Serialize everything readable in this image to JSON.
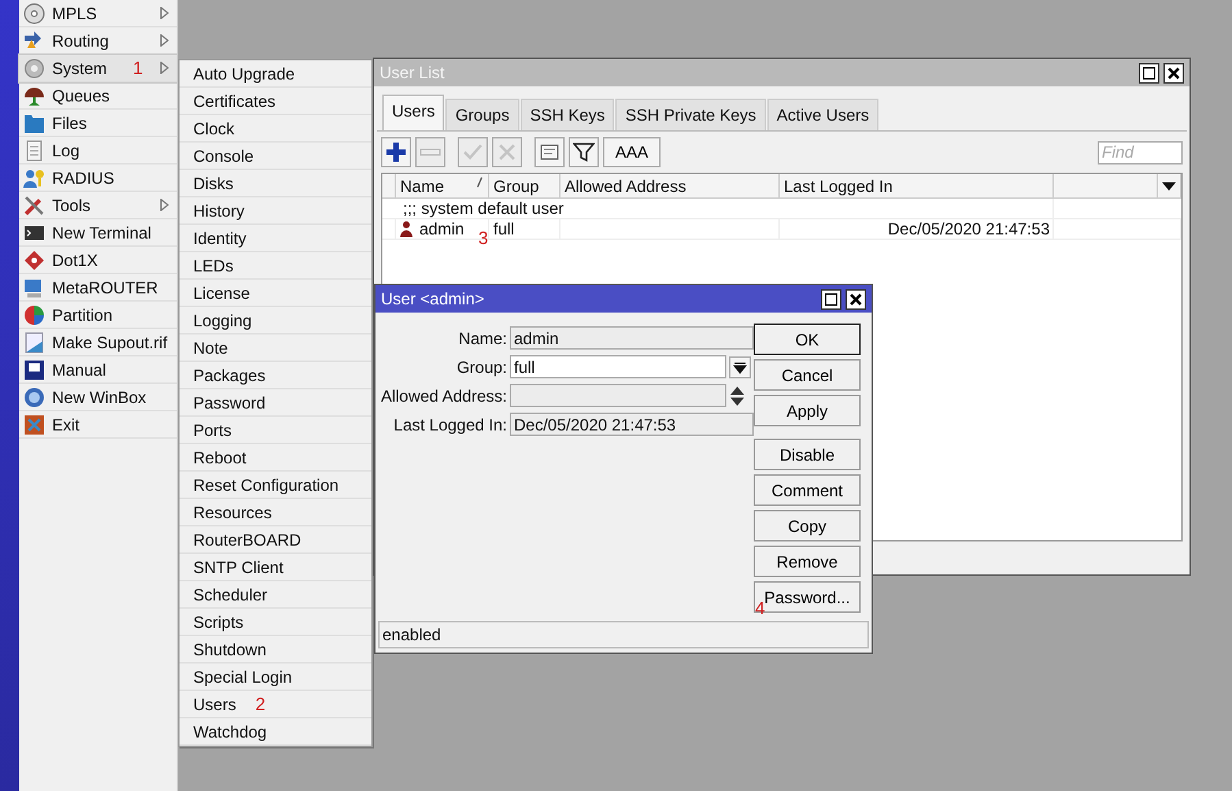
{
  "main_menu": [
    {
      "label": "MPLS",
      "has_submenu": true,
      "selected": false
    },
    {
      "label": "Routing",
      "has_submenu": true,
      "selected": false
    },
    {
      "label": "System",
      "has_submenu": true,
      "selected": true,
      "annotation": "1"
    },
    {
      "label": "Queues",
      "has_submenu": false,
      "selected": false
    },
    {
      "label": "Files",
      "has_submenu": false,
      "selected": false
    },
    {
      "label": "Log",
      "has_submenu": false,
      "selected": false
    },
    {
      "label": "RADIUS",
      "has_submenu": false,
      "selected": false
    },
    {
      "label": "Tools",
      "has_submenu": true,
      "selected": false
    },
    {
      "label": "New Terminal",
      "has_submenu": false,
      "selected": false
    },
    {
      "label": "Dot1X",
      "has_submenu": false,
      "selected": false
    },
    {
      "label": "MetaROUTER",
      "has_submenu": false,
      "selected": false
    },
    {
      "label": "Partition",
      "has_submenu": false,
      "selected": false
    },
    {
      "label": "Make Supout.rif",
      "has_submenu": false,
      "selected": false
    },
    {
      "label": "Manual",
      "has_submenu": false,
      "selected": false
    },
    {
      "label": "New WinBox",
      "has_submenu": false,
      "selected": false
    },
    {
      "label": "Exit",
      "has_submenu": false,
      "selected": false
    }
  ],
  "submenu": [
    {
      "label": "Auto Upgrade"
    },
    {
      "label": "Certificates"
    },
    {
      "label": "Clock"
    },
    {
      "label": "Console"
    },
    {
      "label": "Disks"
    },
    {
      "label": "History"
    },
    {
      "label": "Identity"
    },
    {
      "label": "LEDs"
    },
    {
      "label": "License"
    },
    {
      "label": "Logging"
    },
    {
      "label": "Note"
    },
    {
      "label": "Packages"
    },
    {
      "label": "Password"
    },
    {
      "label": "Ports"
    },
    {
      "label": "Reboot"
    },
    {
      "label": "Reset Configuration"
    },
    {
      "label": "Resources"
    },
    {
      "label": "RouterBOARD"
    },
    {
      "label": "SNTP Client"
    },
    {
      "label": "Scheduler"
    },
    {
      "label": "Scripts"
    },
    {
      "label": "Shutdown"
    },
    {
      "label": "Special Login"
    },
    {
      "label": "Users",
      "annotation": "2"
    },
    {
      "label": "Watchdog"
    }
  ],
  "user_list": {
    "title": "User List",
    "tabs": [
      {
        "label": "Users",
        "selected": true
      },
      {
        "label": "Groups",
        "selected": false
      },
      {
        "label": "SSH Keys",
        "selected": false
      },
      {
        "label": "SSH Private Keys",
        "selected": false
      },
      {
        "label": "Active Users",
        "selected": false
      }
    ],
    "toolbar": [
      {
        "kind": "add",
        "disabled": false
      },
      {
        "kind": "remove",
        "disabled": true
      },
      {
        "kind": "enable",
        "disabled": true
      },
      {
        "kind": "disable",
        "disabled": true
      },
      {
        "kind": "comment",
        "disabled": false
      },
      {
        "kind": "filter",
        "disabled": false
      },
      {
        "kind": "text",
        "label": "AAA",
        "disabled": false
      }
    ],
    "search": {
      "placeholder": "Find"
    },
    "columns": [
      "Name",
      "Group",
      "Allowed Address",
      "Last Logged In"
    ],
    "rows": [
      {
        "kind": "comment",
        "text": ";;; system default user"
      },
      {
        "kind": "item",
        "name": "admin",
        "group": "full",
        "last_logged_in": "Dec/05/2020 21:47:53",
        "annotation": "3"
      }
    ]
  },
  "user_dialog": {
    "title": "User <admin>",
    "fields": [
      {
        "label": "Name:",
        "kind": "readonly",
        "value": "admin"
      },
      {
        "label": "Group:",
        "kind": "dropdown",
        "value": "full"
      },
      {
        "label": "Allowed Address:",
        "kind": "spinner"
      },
      {
        "label": "Last Logged In:",
        "kind": "readonly",
        "value": "Dec/05/2020 21:47:53"
      }
    ],
    "buttons": [
      {
        "label": "OK",
        "default": true
      },
      {
        "label": "Cancel",
        "default": false
      },
      {
        "label": "Apply",
        "default": false
      },
      {
        "label": "Disable",
        "default": false
      },
      {
        "label": "Comment",
        "default": false
      },
      {
        "label": "Copy",
        "default": false
      },
      {
        "label": "Remove",
        "default": false
      },
      {
        "label": "Password...",
        "default": false,
        "annotation": "4"
      }
    ],
    "status": "enabled"
  }
}
